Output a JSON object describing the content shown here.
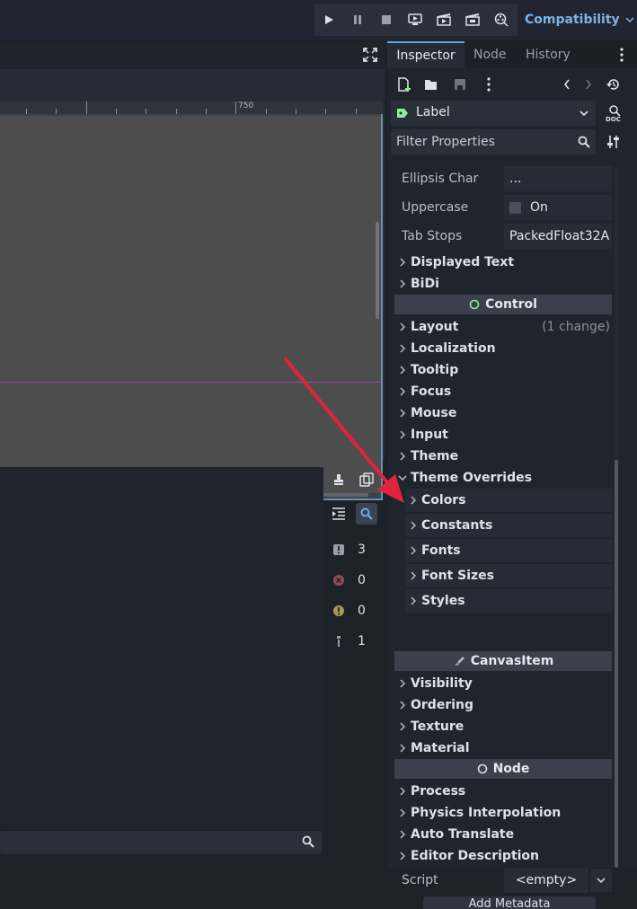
{
  "topbar": {
    "renderer_label": "Compatibility",
    "run_buttons": [
      "play-icon",
      "pause-icon",
      "stop-icon",
      "remote-debug-icon",
      "play-scene-icon",
      "play-custom-scene-icon",
      "movie-maker-icon"
    ]
  },
  "viewport": {
    "ruler_label": "750"
  },
  "output": {
    "counts": [
      {
        "icon": "message-icon",
        "value": "3"
      },
      {
        "icon": "error-icon",
        "value": "0"
      },
      {
        "icon": "warning-icon",
        "value": "0"
      },
      {
        "icon": "editor-message-icon",
        "value": "1"
      }
    ]
  },
  "inspector": {
    "tabs": [
      "Inspector",
      "Node",
      "History"
    ],
    "node_type": "Label",
    "filter_placeholder": "Filter Properties",
    "properties": [
      {
        "name": "Ellipsis Char",
        "value": "..."
      },
      {
        "name": "Uppercase",
        "value": "On"
      },
      {
        "name": "Tab Stops",
        "value": "PackedFloat32A"
      }
    ],
    "sections_1": [
      "Displayed Text",
      "BiDi"
    ],
    "category_control": "Control",
    "control_sections": [
      {
        "label": "Layout",
        "aux": "(1 change)"
      },
      {
        "label": "Localization",
        "aux": ""
      },
      {
        "label": "Tooltip",
        "aux": ""
      },
      {
        "label": "Focus",
        "aux": ""
      },
      {
        "label": "Mouse",
        "aux": ""
      },
      {
        "label": "Input",
        "aux": ""
      },
      {
        "label": "Theme",
        "aux": ""
      },
      {
        "label": "Theme Overrides",
        "aux": ""
      }
    ],
    "theme_overrides": [
      "Colors",
      "Constants",
      "Fonts",
      "Font Sizes",
      "Styles"
    ],
    "category_canvasitem": "CanvasItem",
    "canvasitem_sections": [
      "Visibility",
      "Ordering",
      "Texture",
      "Material"
    ],
    "category_node": "Node",
    "node_sections": [
      "Process",
      "Physics Interpolation",
      "Auto Translate",
      "Editor Description"
    ],
    "script_label": "Script",
    "script_value": "<empty>",
    "add_metadata": "Add Metadata"
  },
  "colors": {
    "accent": "#7fb3e6",
    "annotation_arrow": "#e0253a",
    "control_circle": "#8eef97"
  }
}
